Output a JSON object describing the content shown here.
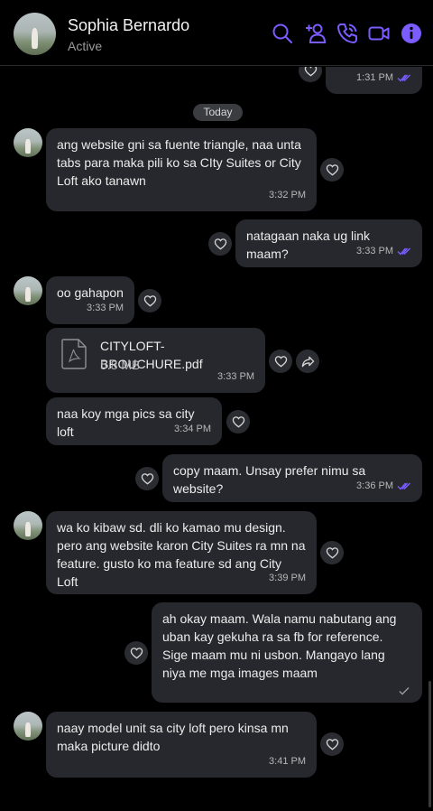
{
  "header": {
    "contact_name": "Sophia Bernardo",
    "status": "Active",
    "accent": "#7b5cff"
  },
  "day_separator": "Today",
  "messages": [
    {
      "id": "m0",
      "side": "out",
      "text": "",
      "time": "1:31 PM",
      "seen": true
    },
    {
      "id": "m1",
      "side": "in",
      "text": "ang website gni sa fuente triangle, naa unta tabs para maka pili ko sa CIty Suites or City Loft ako tanawn",
      "time": "3:32 PM"
    },
    {
      "id": "m2",
      "side": "out",
      "text": "natagaan naka ug link maam?",
      "time": "3:33 PM",
      "seen": true
    },
    {
      "id": "m3",
      "side": "in",
      "text": "oo gahapon",
      "time": "3:33 PM"
    },
    {
      "id": "m4",
      "side": "in",
      "type": "file",
      "file_name": "CITYLOFT-BROUCHURE.pdf",
      "file_size": "5.8 MB",
      "time": "3:33 PM"
    },
    {
      "id": "m5",
      "side": "in",
      "text": "naa koy mga pics sa city loft",
      "time": "3:34 PM"
    },
    {
      "id": "m6",
      "side": "out",
      "text": "copy maam. Unsay prefer nimu sa website?",
      "time": "3:36 PM",
      "seen": true
    },
    {
      "id": "m7",
      "side": "in",
      "text": "wa ko kibaw sd. dli ko kamao mu design. pero ang website karon City Suites ra mn na feature. gusto ko ma feature sd ang City Loft",
      "time": "3:39 PM"
    },
    {
      "id": "m8",
      "side": "out",
      "text": "ah okay maam. Wala namu nabutang ang uban kay gekuha ra sa fb for reference. Sige maam mu ni usbon. Mangayo lang niya me mga images maam",
      "time": "",
      "sent": true
    },
    {
      "id": "m9",
      "side": "in",
      "text": "naay model unit sa city loft pero kinsa mn maka picture didto",
      "time": "3:41 PM"
    }
  ],
  "icons": [
    "search-icon",
    "add-person-icon",
    "phone-icon",
    "video-icon",
    "info-icon",
    "heart-icon",
    "forward-icon",
    "pdf-file-icon",
    "seen-tick-icon",
    "sent-tick-icon"
  ]
}
